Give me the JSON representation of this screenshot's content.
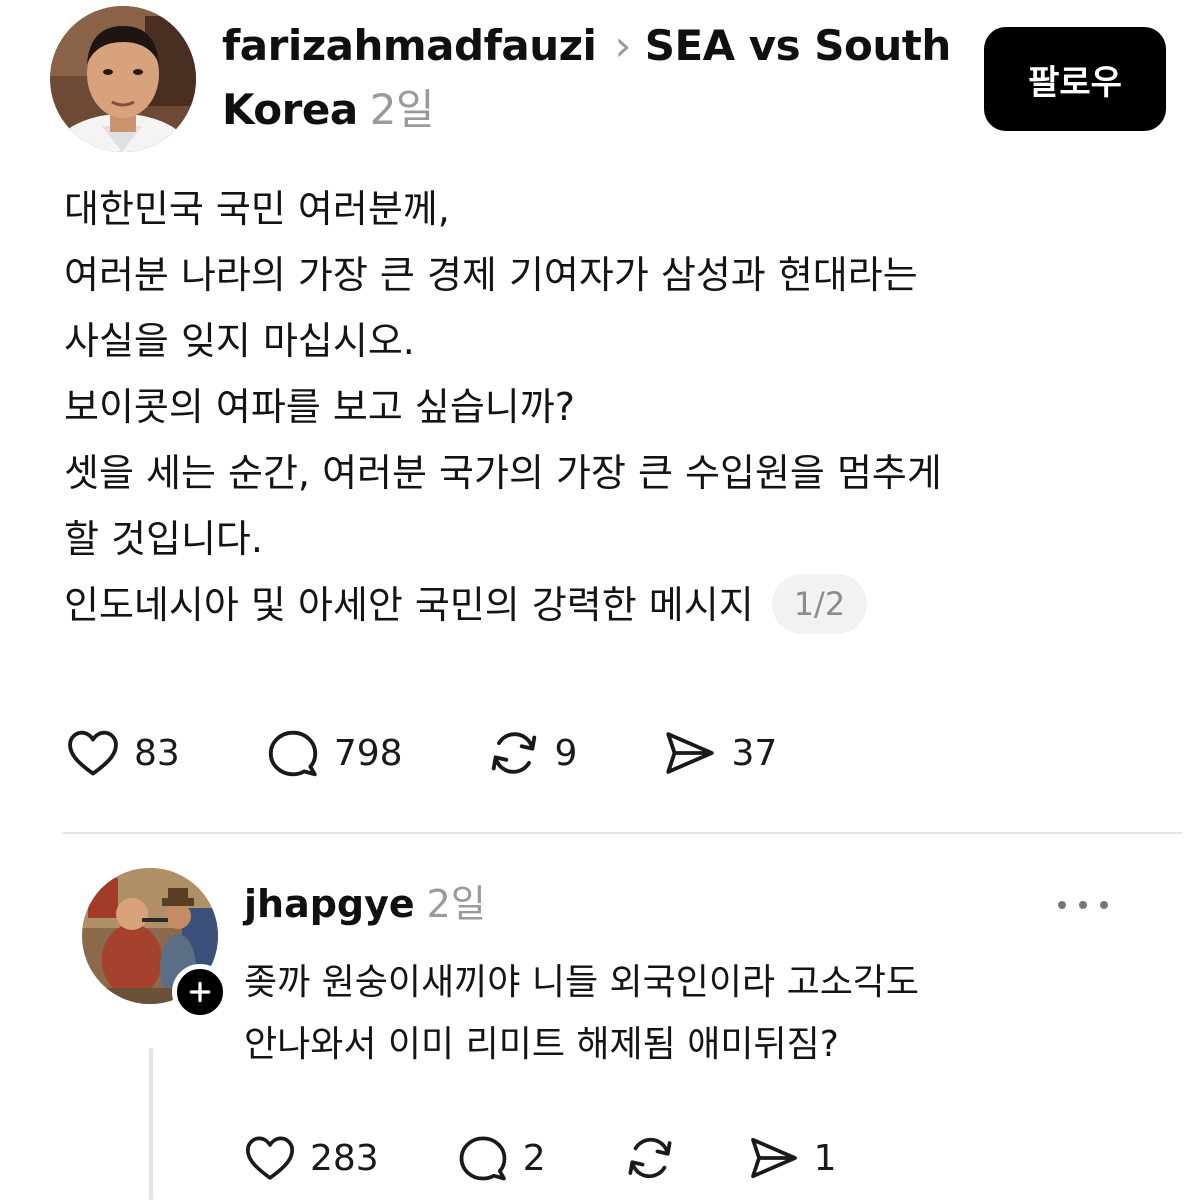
{
  "post": {
    "author": "farizahmadfauzi",
    "topic_line1": "SEA vs South",
    "topic_line2": "Korea",
    "time": "2일",
    "follow_label": "팔로우",
    "body_lines": [
      "대한민국 국민 여러분께,",
      "여러분 나라의 가장 큰 경제 기여자가 삼성과 현대라는",
      "사실을 잊지 마십시오.",
      "보이콧의 여파를 보고 싶습니까?",
      "셋을 세는 순간, 여러분 국가의 가장 큰 수입원을 멈추게",
      "할 것입니다.",
      "인도네시아 및 아세안 국민의 강력한 메시지"
    ],
    "page_indicator": "1/2",
    "likes": "83",
    "replies": "798",
    "reposts": "9",
    "shares": "37"
  },
  "reply": {
    "author": "jhapgye",
    "time": "2일",
    "body_lines": [
      "좆까 원숭이새끼야 니들 외국인이라 고소각도",
      "안나와서 이미 리미트 해제됨 애미뒤짐?"
    ],
    "likes": "283",
    "replies": "2",
    "shares": "1"
  },
  "icons": {
    "like": "heart-icon",
    "reply": "speech-bubble-icon",
    "repost": "repost-arrows-icon",
    "share": "paper-plane-icon",
    "chevron": "chevron-right-icon",
    "follow_plus": "plus-icon",
    "more": "more-dots-icon"
  },
  "colors": {
    "text": "#101010",
    "muted": "#9a9a9a",
    "button_bg": "#000000",
    "pill_bg": "#f2f2f2",
    "divider": "#e5e5e5"
  }
}
